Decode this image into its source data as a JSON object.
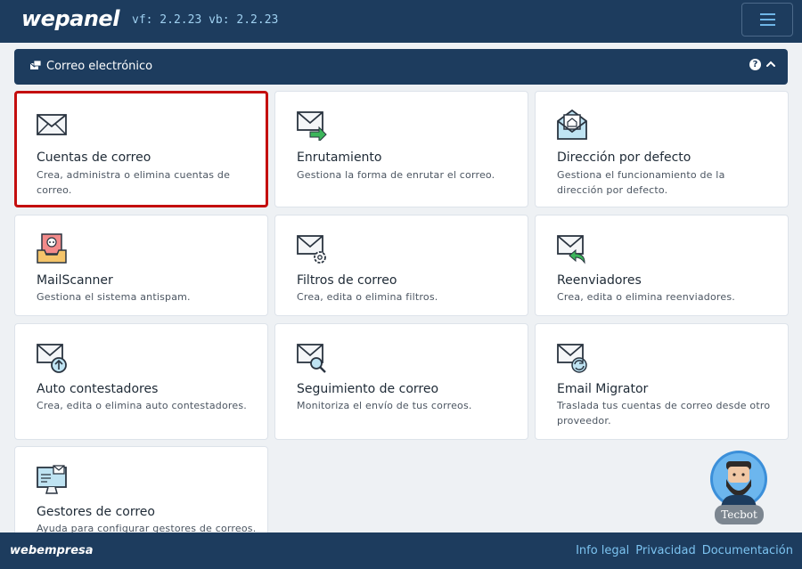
{
  "header": {
    "logo": "wepanel",
    "version": "vf: 2.2.23 vb: 2.2.23"
  },
  "section": {
    "title": "Correo electrónico",
    "help": "?"
  },
  "cards": [
    {
      "title": "Cuentas de correo",
      "desc": "Crea, administra o elimina cuentas de correo.",
      "icon": "envelope-icon",
      "selected": true
    },
    {
      "title": "Enrutamiento",
      "desc": "Gestiona la forma de enrutar el correo.",
      "icon": "envelope-arrow-icon"
    },
    {
      "title": "Dirección por defecto",
      "desc": "Gestiona el funcionamiento de la dirección por defecto.",
      "icon": "envelope-home-icon"
    },
    {
      "title": "MailScanner",
      "desc": "Gestiona el sistema antispam.",
      "icon": "skull-inbox-icon"
    },
    {
      "title": "Filtros de correo",
      "desc": "Crea, edita o elimina filtros.",
      "icon": "envelope-gear-icon"
    },
    {
      "title": "Reenviadores",
      "desc": "Crea, edita o elimina reenviadores.",
      "icon": "envelope-forward-icon"
    },
    {
      "title": "Auto contestadores",
      "desc": "Crea, edita o elimina auto contestadores.",
      "icon": "envelope-upload-icon"
    },
    {
      "title": "Seguimiento de correo",
      "desc": "Monitoriza el envío de tus correos.",
      "icon": "envelope-search-icon"
    },
    {
      "title": "Email Migrator",
      "desc": "Traslada tus cuentas de correo desde otro proveedor.",
      "icon": "envelope-sync-icon"
    },
    {
      "title": "Gestores de correo",
      "desc": "Ayuda para configurar gestores de correos.",
      "icon": "monitor-mail-icon"
    }
  ],
  "footer": {
    "logo": "webempresa",
    "links": [
      "Info legal",
      "Privacidad",
      "Documentación"
    ]
  },
  "bot": {
    "label": "Tecbot"
  }
}
